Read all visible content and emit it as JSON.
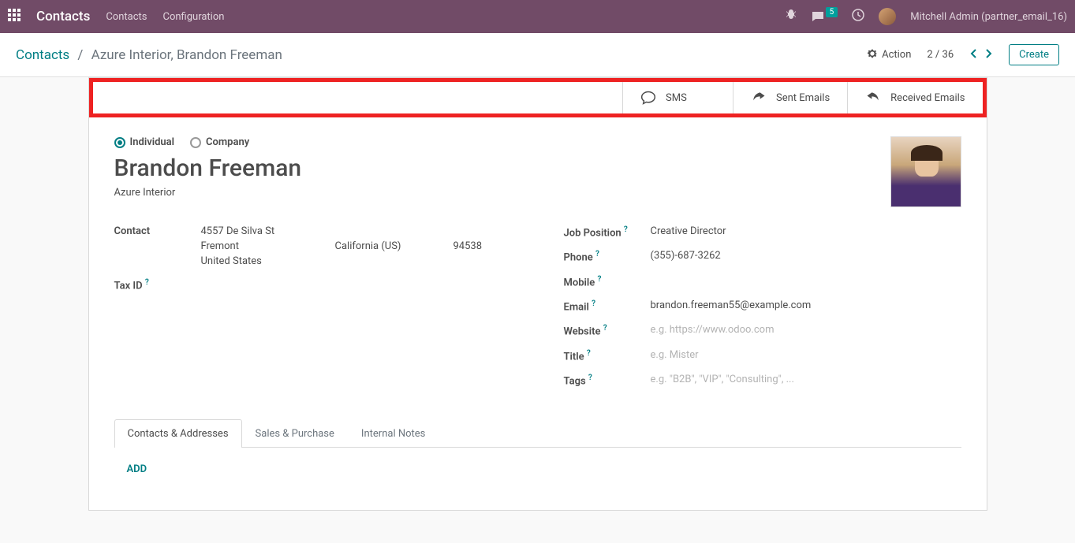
{
  "topbar": {
    "brand": "Contacts",
    "nav": [
      "Contacts",
      "Configuration"
    ],
    "msg_count": "5",
    "username": "Mitchell Admin (partner_email_16)"
  },
  "header": {
    "breadcrumb_root": "Contacts",
    "breadcrumb_current": "Azure Interior, Brandon Freeman",
    "action_label": "Action",
    "pager": "2 / 36",
    "create_label": "Create"
  },
  "stat_buttons": {
    "sms": "SMS",
    "sent": "Sent Emails",
    "received": "Received Emails"
  },
  "form": {
    "radio_individual": "Individual",
    "radio_company": "Company",
    "name": "Brandon Freeman",
    "company": "Azure Interior",
    "labels": {
      "contact": "Contact",
      "tax_id": "Tax ID",
      "job_position": "Job Position",
      "phone": "Phone",
      "mobile": "Mobile",
      "email": "Email",
      "website": "Website",
      "title": "Title",
      "tags": "Tags"
    },
    "address": {
      "street": "4557 De Silva St",
      "city": "Fremont",
      "state": "California (US)",
      "zip": "94538",
      "country": "United States"
    },
    "job_position": "Creative Director",
    "phone": "(355)-687-3262",
    "email": "brandon.freeman55@example.com",
    "placeholders": {
      "website": "e.g. https://www.odoo.com",
      "title": "e.g. Mister",
      "tags": "e.g. \"B2B\", \"VIP\", \"Consulting\", ..."
    }
  },
  "tabs": {
    "contacts_addresses": "Contacts & Addresses",
    "sales_purchase": "Sales & Purchase",
    "internal_notes": "Internal Notes",
    "add": "ADD"
  }
}
